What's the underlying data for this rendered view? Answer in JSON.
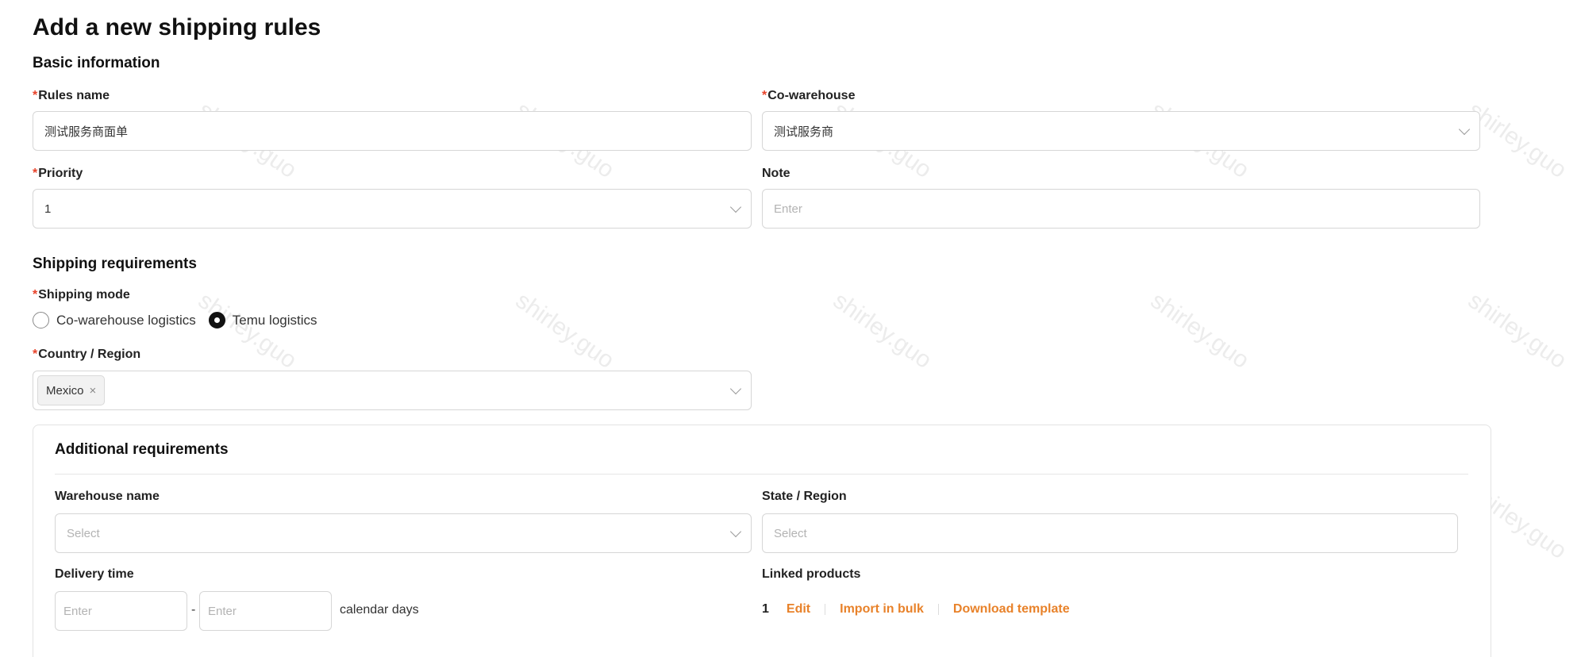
{
  "page": {
    "title": "Add a new shipping rules"
  },
  "basic_info": {
    "section_title": "Basic information",
    "rules_name": {
      "label": "Rules name",
      "value": "测试服务商面单"
    },
    "co_warehouse": {
      "label": "Co-warehouse",
      "value": "测试服务商"
    },
    "priority": {
      "label": "Priority",
      "value": "1"
    },
    "note": {
      "label": "Note",
      "placeholder": "Enter"
    }
  },
  "shipping_requirements": {
    "section_title": "Shipping requirements",
    "shipping_mode": {
      "label": "Shipping mode",
      "options": [
        {
          "label": "Co-warehouse logistics",
          "checked": false
        },
        {
          "label": "Temu logistics",
          "checked": true
        }
      ]
    },
    "country_region": {
      "label": "Country / Region",
      "tags": [
        "Mexico"
      ],
      "tag_close": "×"
    }
  },
  "additional_requirements": {
    "section_title": "Additional requirements",
    "warehouse_name": {
      "label": "Warehouse name",
      "placeholder": "Select"
    },
    "state_region": {
      "label": "State / Region",
      "placeholder": "Select"
    },
    "delivery_time": {
      "label": "Delivery time",
      "from_placeholder": "Enter",
      "to_placeholder": "Enter",
      "separator": "-",
      "suffix": "calendar days"
    },
    "linked_products": {
      "label": "Linked products",
      "count": "1",
      "actions": [
        "Edit",
        "Import in bulk",
        "Download template"
      ]
    }
  },
  "watermark": {
    "text": "shirley.guo"
  },
  "colors": {
    "required_star": "#e8432a",
    "link_accent": "#e8822a",
    "radio_checked": "#111111"
  }
}
